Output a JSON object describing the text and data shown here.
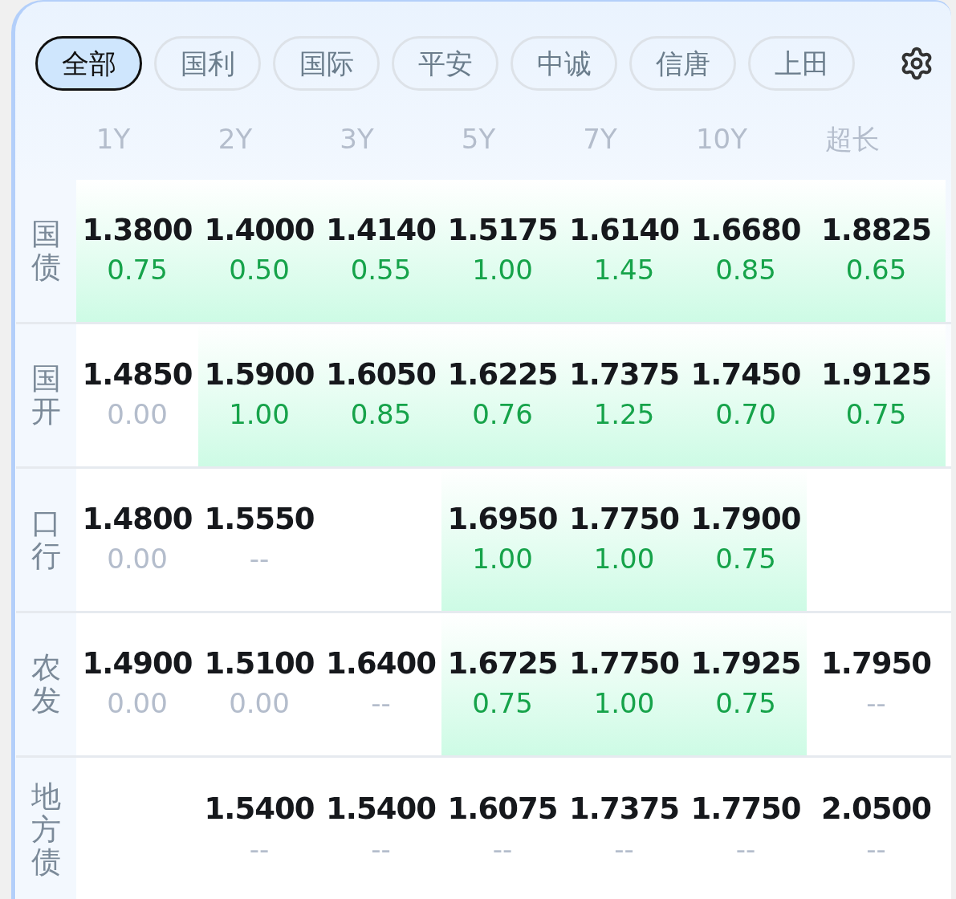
{
  "tabs": [
    {
      "label": "全部",
      "selected": true
    },
    {
      "label": "国利",
      "selected": false
    },
    {
      "label": "国际",
      "selected": false
    },
    {
      "label": "平安",
      "selected": false
    },
    {
      "label": "中诚",
      "selected": false
    },
    {
      "label": "信唐",
      "selected": false
    },
    {
      "label": "上田",
      "selected": false
    }
  ],
  "columns": [
    "1Y",
    "2Y",
    "3Y",
    "5Y",
    "7Y",
    "10Y",
    "超长"
  ],
  "rows": [
    {
      "label": "国债",
      "cells": [
        {
          "rate": "1.3800",
          "change": "0.75",
          "kind": "up",
          "highlighted": true
        },
        {
          "rate": "1.4000",
          "change": "0.50",
          "kind": "up",
          "highlighted": true
        },
        {
          "rate": "1.4140",
          "change": "0.55",
          "kind": "up",
          "highlighted": true
        },
        {
          "rate": "1.5175",
          "change": "1.00",
          "kind": "up",
          "highlighted": true
        },
        {
          "rate": "1.6140",
          "change": "1.45",
          "kind": "up",
          "highlighted": true
        },
        {
          "rate": "1.6680",
          "change": "0.85",
          "kind": "up",
          "highlighted": true
        },
        {
          "rate": "1.8825",
          "change": "0.65",
          "kind": "up",
          "highlighted": true
        }
      ]
    },
    {
      "label": "国开",
      "cells": [
        {
          "rate": "1.4850",
          "change": "0.00",
          "kind": "flat",
          "highlighted": false
        },
        {
          "rate": "1.5900",
          "change": "1.00",
          "kind": "up",
          "highlighted": true
        },
        {
          "rate": "1.6050",
          "change": "0.85",
          "kind": "up",
          "highlighted": true
        },
        {
          "rate": "1.6225",
          "change": "0.76",
          "kind": "up",
          "highlighted": true
        },
        {
          "rate": "1.7375",
          "change": "1.25",
          "kind": "up",
          "highlighted": true
        },
        {
          "rate": "1.7450",
          "change": "0.70",
          "kind": "up",
          "highlighted": true
        },
        {
          "rate": "1.9125",
          "change": "0.75",
          "kind": "up",
          "highlighted": true
        }
      ]
    },
    {
      "label": "口行",
      "cells": [
        {
          "rate": "1.4800",
          "change": "0.00",
          "kind": "flat",
          "highlighted": false
        },
        {
          "rate": "1.5550",
          "change": "--",
          "kind": "flat",
          "highlighted": false
        },
        null,
        {
          "rate": "1.6950",
          "change": "1.00",
          "kind": "up",
          "highlighted": true
        },
        {
          "rate": "1.7750",
          "change": "1.00",
          "kind": "up",
          "highlighted": true
        },
        {
          "rate": "1.7900",
          "change": "0.75",
          "kind": "up",
          "highlighted": true
        },
        null
      ]
    },
    {
      "label": "农发",
      "cells": [
        {
          "rate": "1.4900",
          "change": "0.00",
          "kind": "flat",
          "highlighted": false
        },
        {
          "rate": "1.5100",
          "change": "0.00",
          "kind": "flat",
          "highlighted": false
        },
        {
          "rate": "1.6400",
          "change": "--",
          "kind": "flat",
          "highlighted": false
        },
        {
          "rate": "1.6725",
          "change": "0.75",
          "kind": "up",
          "highlighted": true
        },
        {
          "rate": "1.7750",
          "change": "1.00",
          "kind": "up",
          "highlighted": true
        },
        {
          "rate": "1.7925",
          "change": "0.75",
          "kind": "up",
          "highlighted": true
        },
        {
          "rate": "1.7950",
          "change": "--",
          "kind": "flat",
          "highlighted": false
        }
      ]
    },
    {
      "label": "地方债",
      "cells": [
        null,
        {
          "rate": "1.5400",
          "change": "--",
          "kind": "flat",
          "highlighted": false
        },
        {
          "rate": "1.5400",
          "change": "--",
          "kind": "flat",
          "highlighted": false
        },
        {
          "rate": "1.6075",
          "change": "--",
          "kind": "flat",
          "highlighted": false
        },
        {
          "rate": "1.7375",
          "change": "--",
          "kind": "flat",
          "highlighted": false
        },
        {
          "rate": "1.7750",
          "change": "--",
          "kind": "flat",
          "highlighted": false
        },
        {
          "rate": "2.0500",
          "change": "--",
          "kind": "flat",
          "highlighted": false
        }
      ]
    }
  ]
}
